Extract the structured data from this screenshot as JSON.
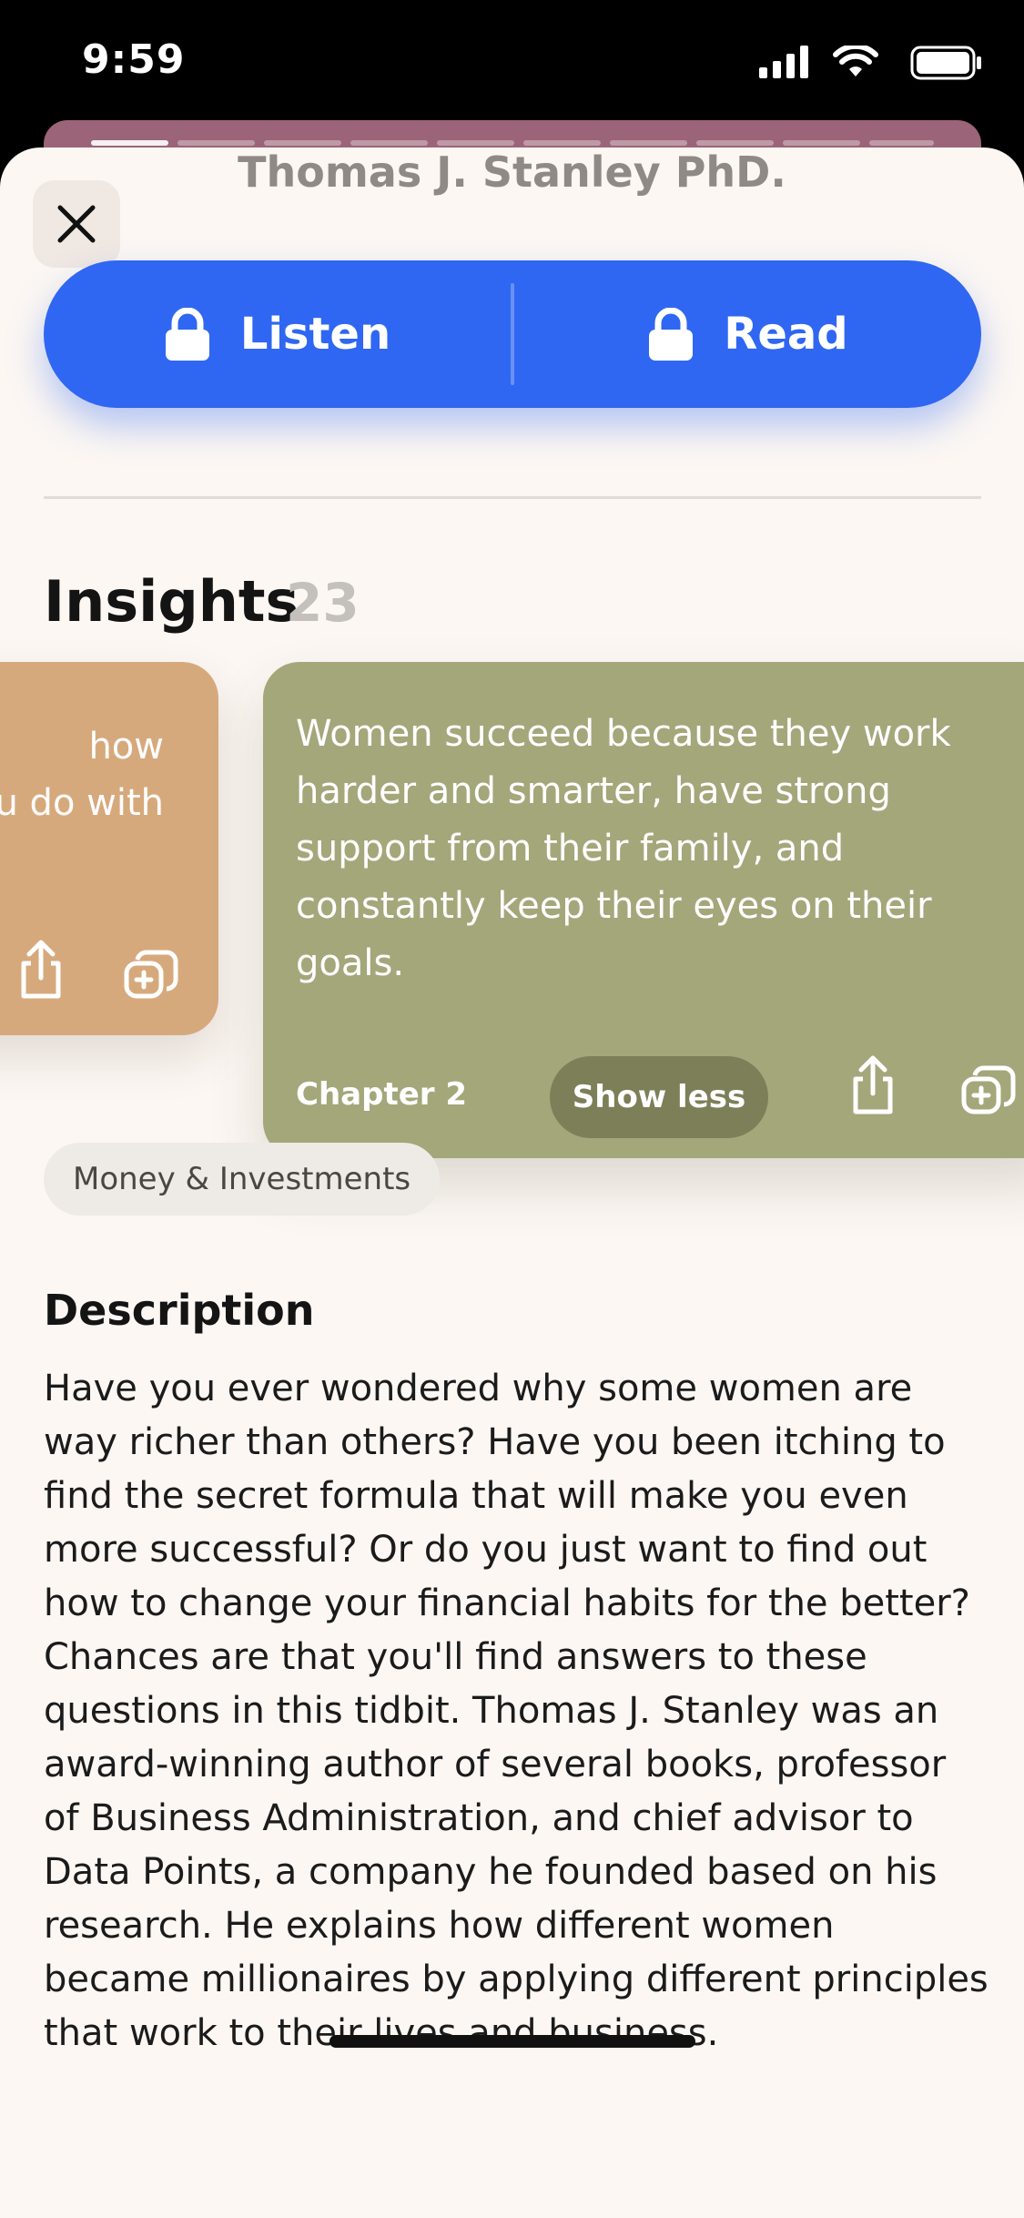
{
  "status_bar": {
    "time": "9:59",
    "icons": [
      "cellular-signal-icon",
      "wifi-icon",
      "battery-icon"
    ]
  },
  "sheet": {
    "author": "Thomas J. Stanley PhD.",
    "close_icon": "close-icon",
    "actions": {
      "listen_label": "Listen",
      "read_label": "Read",
      "lock_icon": "lock-icon",
      "color": "#2f67f2"
    }
  },
  "insights": {
    "title": "Insights",
    "count": "23",
    "cards": [
      {
        "snippet_lines": [
          "how",
          "u do with"
        ],
        "color": "#d6a97c",
        "icons": [
          "share-icon",
          "add-to-collection-icon"
        ]
      },
      {
        "text": "Women succeed because they work harder and smarter, have strong support from their family, and constantly keep their eyes on their goals.",
        "chapter": "Chapter 2",
        "toggle_label": "Show less",
        "color": "#a3a77a",
        "icons": [
          "share-icon",
          "add-to-collection-icon"
        ]
      }
    ]
  },
  "tag": {
    "label": "Money & Investments"
  },
  "description": {
    "title": "Description",
    "body": "Have you ever wondered why some women are way richer than others? Have you been itching to find the secret formula that will make you even more successful? Or do you just want to find out how to change your financial habits for the better? Chances are that you'll find answers to these questions in this tidbit. Thomas J. Stanley was an award-winning author of several books, professor of Business Administration, and chief advisor to Data Points, a company he founded based on his research. He explains how different women became millionaires by applying different principles that work to their lives and business."
  }
}
